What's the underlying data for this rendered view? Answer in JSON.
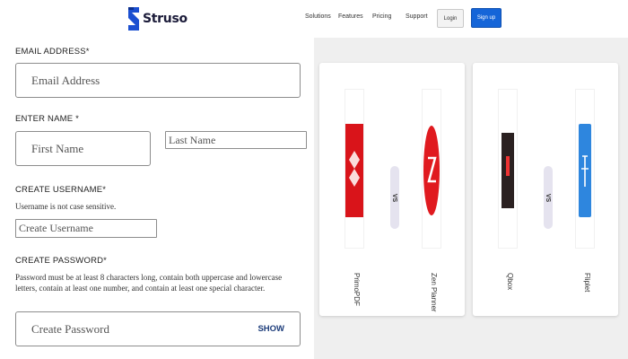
{
  "header": {
    "brand": "Struso",
    "nav": [
      "Solutions",
      "Features",
      "Pricing",
      "Support"
    ],
    "login_label": "Login",
    "signup_label": "Sign up"
  },
  "form": {
    "email": {
      "label": "EMAIL ADDRESS*",
      "placeholder": "Email Address"
    },
    "name": {
      "label": "ENTER NAME *",
      "first_placeholder": "First Name",
      "last_placeholder": "Last Name"
    },
    "username": {
      "label": "CREATE USERNAME*",
      "help": "Username is not case sensitive.",
      "placeholder": "Create Username"
    },
    "password": {
      "label": "CREATE PASSWORD*",
      "help": "Password must be at least 8 characters long, contain both uppercase and lowercase letters, contain at least one number, and contain at least one special character.",
      "placeholder": "Create Password",
      "show_label": "SHOW"
    }
  },
  "comparisons": [
    {
      "left_name": "PrimoPDF",
      "left_color": "#d9141a",
      "vs": "VS",
      "right_name": "Zen Planner",
      "right_color": "#e01a1f"
    },
    {
      "left_name": "Qbox",
      "left_color": "#2a2020",
      "vs": "VS",
      "right_name": "Fliplet",
      "right_color": "#2e86de"
    }
  ],
  "colors": {
    "accent": "#1565d8",
    "panel_bg": "#efefef"
  }
}
